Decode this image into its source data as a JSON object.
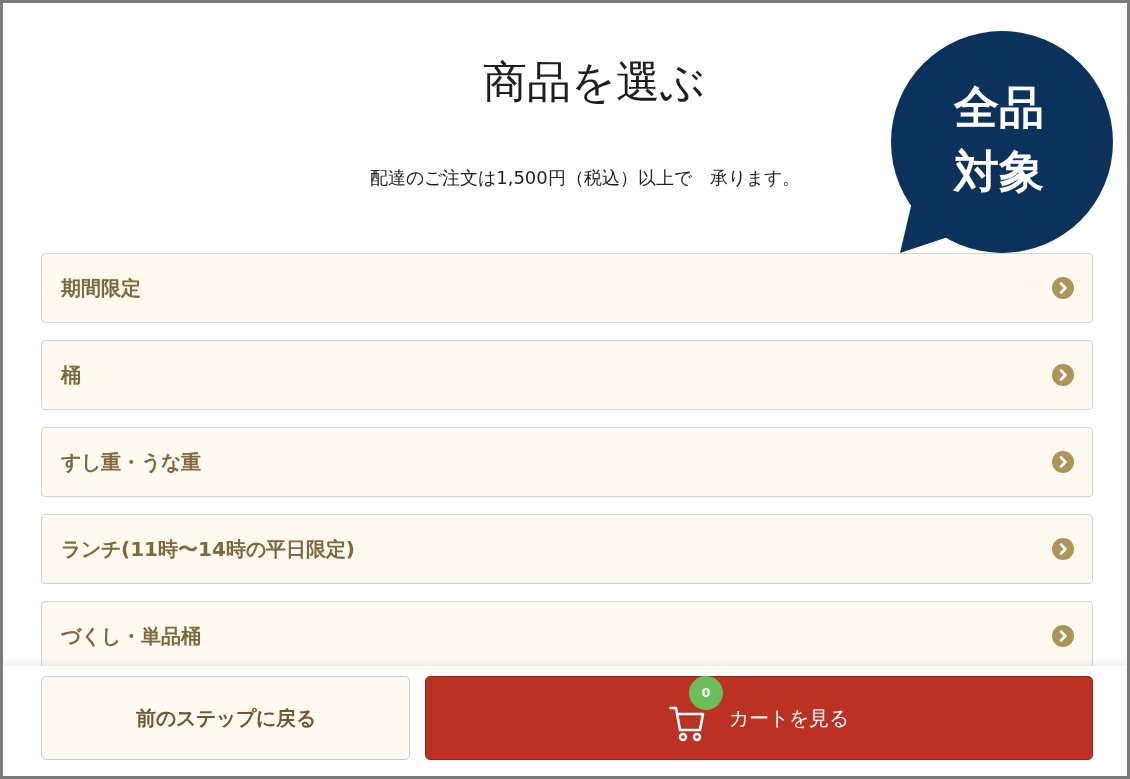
{
  "header": {
    "title": "商品を選ぶ",
    "note": "配達のご注文は1,500円（税込）以上で　承ります。"
  },
  "promo_bubble": {
    "text": "全品対象"
  },
  "categories": [
    {
      "label": "期間限定"
    },
    {
      "label": "桶"
    },
    {
      "label": "すし重・うな重"
    },
    {
      "label": "ランチ(11時〜14時の平日限定)"
    },
    {
      "label": "づくし・単品桶"
    }
  ],
  "footer": {
    "back_button": "前のステップに戻る",
    "cart_button": {
      "label": "カートを見る",
      "count": "0"
    }
  }
}
